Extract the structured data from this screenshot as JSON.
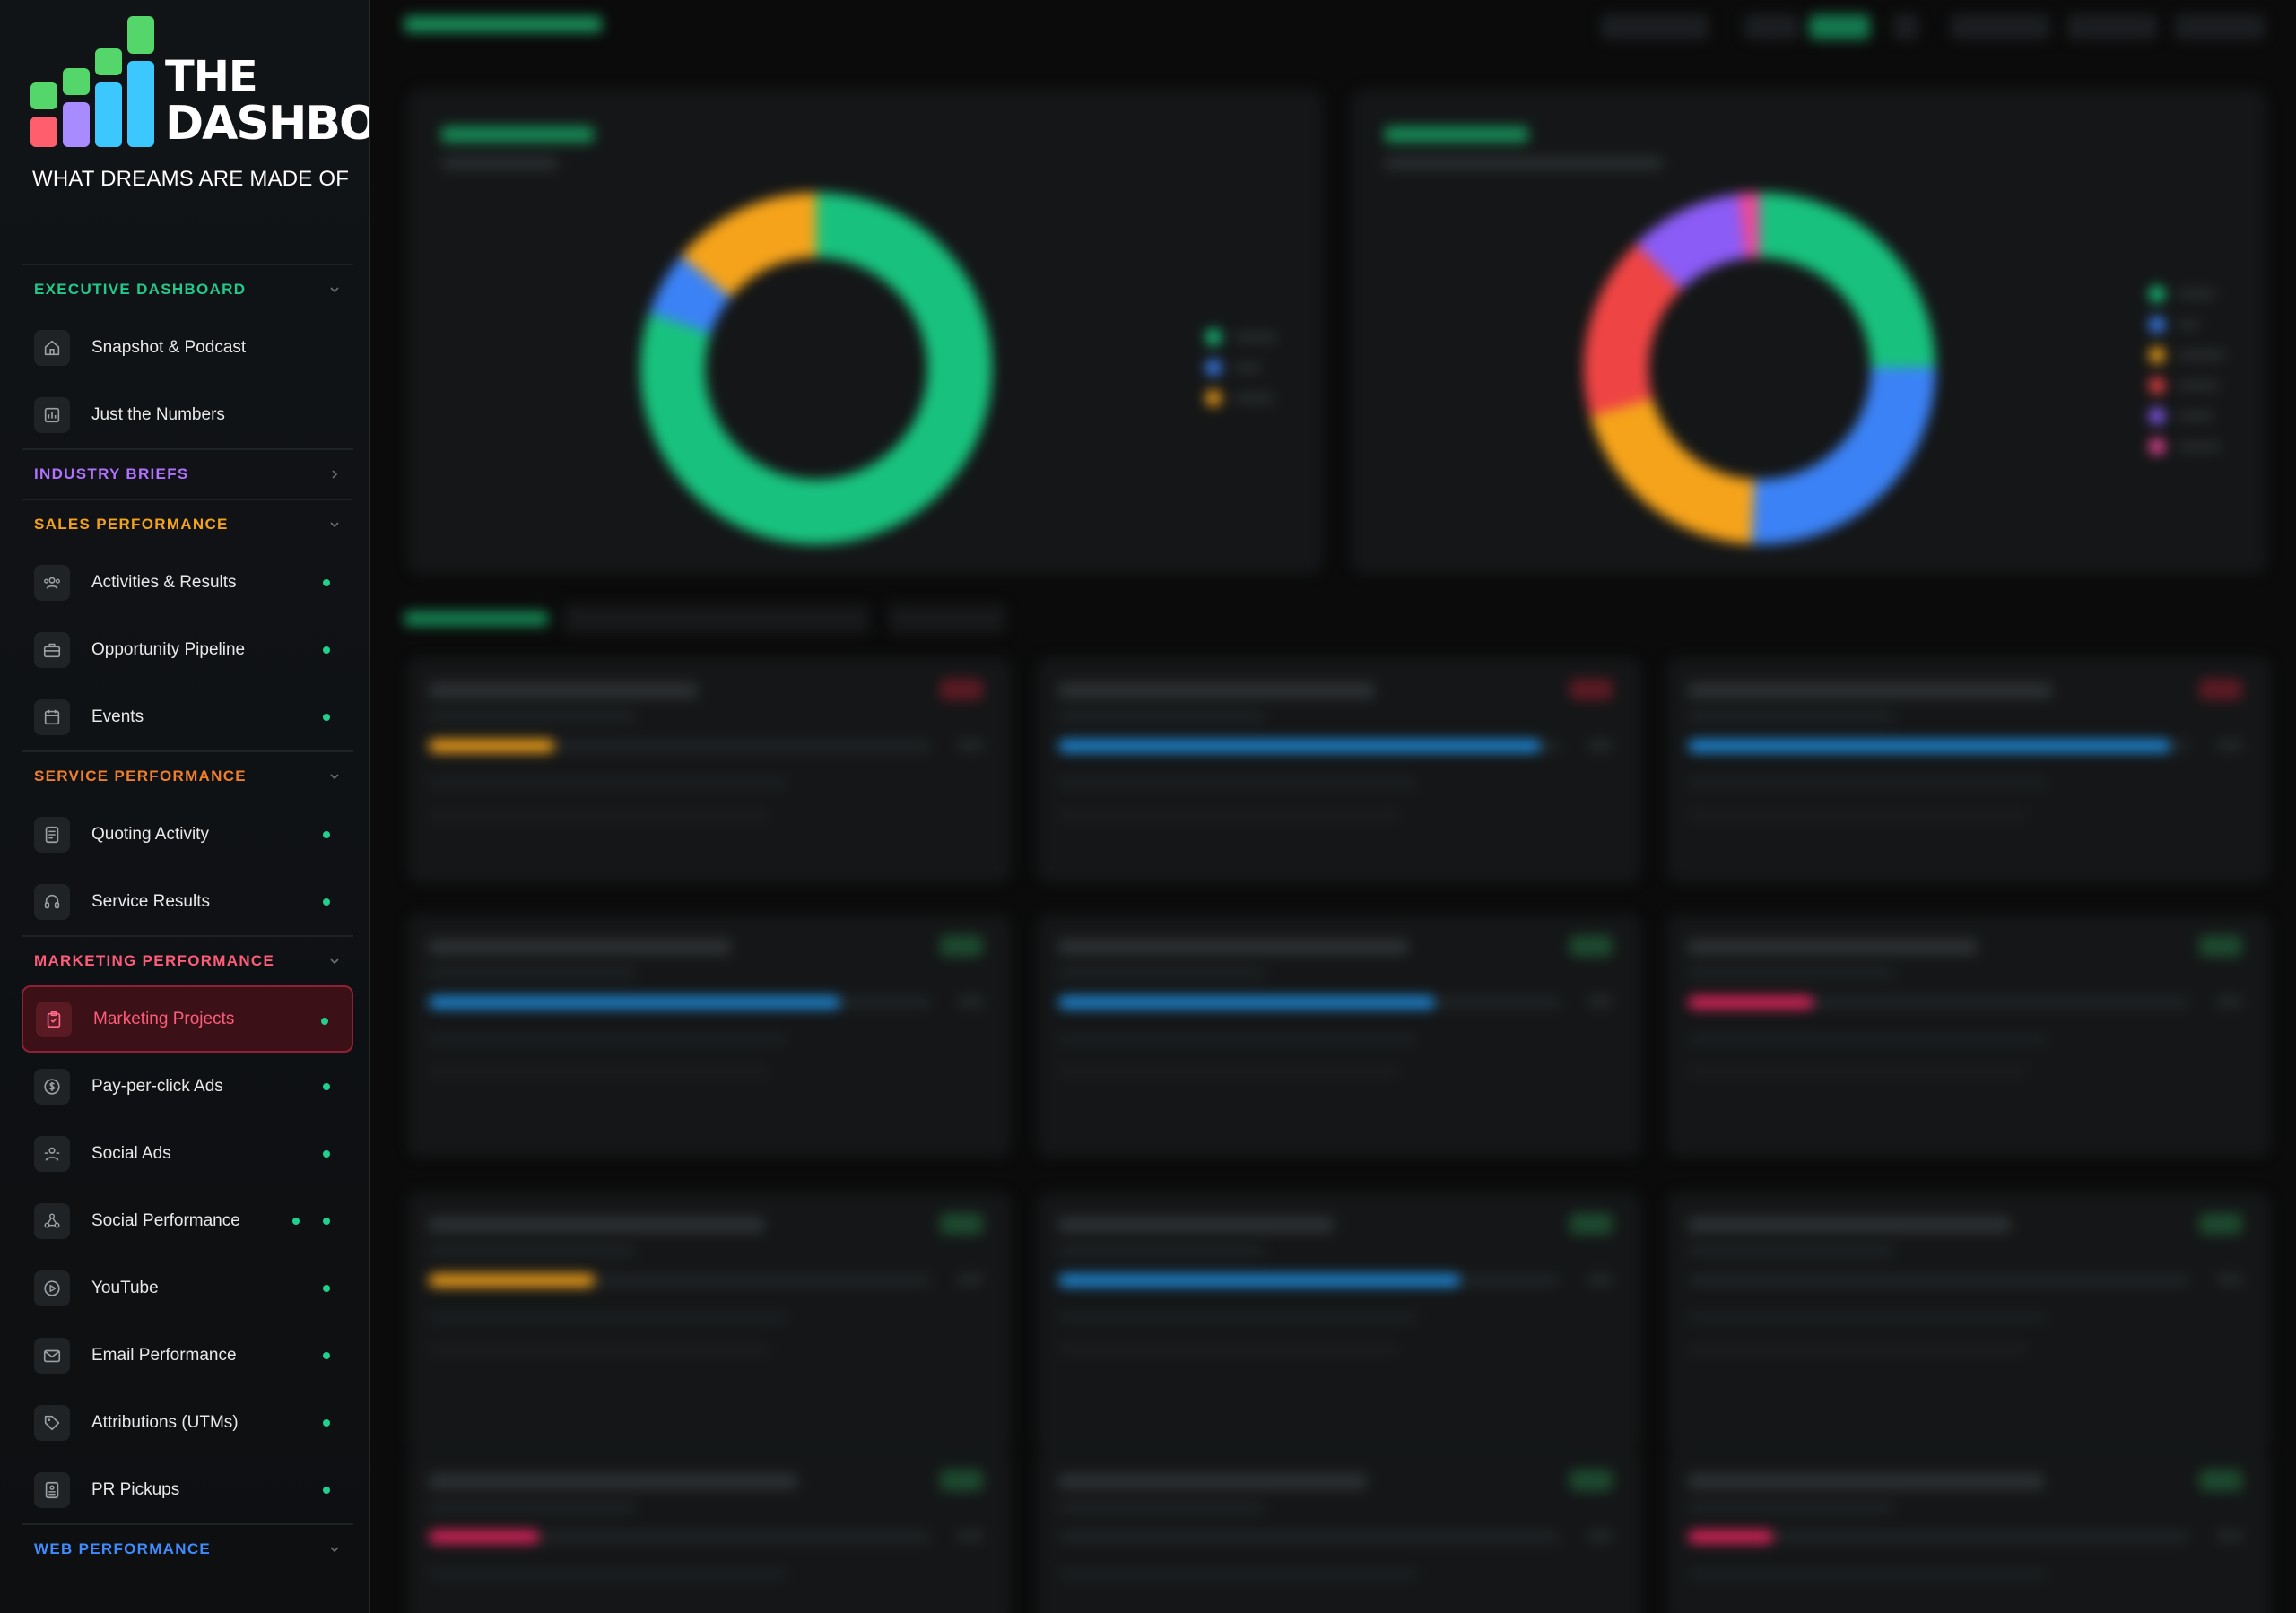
{
  "brand": {
    "title_line1": "THE",
    "title_line2": "DASHBOARD",
    "tagline": "WHAT DREAMS ARE MADE OF"
  },
  "colors": {
    "accent_green": "#1fd08f",
    "exec": "#22c98a",
    "industry": "#b072ff",
    "sales": "#f2a21b",
    "service": "#f07f2b",
    "marketing": "#ff5c7a",
    "web": "#3f8cff"
  },
  "sidebar": {
    "sections": [
      {
        "title": "EXECUTIVE DASHBOARD",
        "color": "#22c98a",
        "chevron": "chevron-down-icon",
        "items": [
          {
            "label": "Snapshot & Podcast",
            "icon": "home-icon",
            "dot": false
          },
          {
            "label": "Just the Numbers",
            "icon": "bar-chart-icon",
            "dot": false
          }
        ]
      },
      {
        "title": "INDUSTRY BRIEFS",
        "color": "#b072ff",
        "chevron": "chevron-right-icon",
        "items": []
      },
      {
        "title": "SALES PERFORMANCE",
        "color": "#f2a21b",
        "chevron": "chevron-down-icon",
        "items": [
          {
            "label": "Activities & Results",
            "icon": "users-icon",
            "dot": true
          },
          {
            "label": "Opportunity Pipeline",
            "icon": "briefcase-icon",
            "dot": true
          },
          {
            "label": "Events",
            "icon": "calendar-icon",
            "dot": true
          }
        ]
      },
      {
        "title": "SERVICE PERFORMANCE",
        "color": "#f07f2b",
        "chevron": "chevron-down-icon",
        "items": [
          {
            "label": "Quoting Activity",
            "icon": "document-icon",
            "dot": true
          },
          {
            "label": "Service Results",
            "icon": "headset-icon",
            "dot": true
          }
        ]
      },
      {
        "title": "MARKETING PERFORMANCE",
        "color": "#ff5c7a",
        "chevron": "chevron-down-icon",
        "items": [
          {
            "label": "Marketing Projects",
            "icon": "clipboard-check-icon",
            "dot": true,
            "active": true
          },
          {
            "label": "Pay-per-click Ads",
            "icon": "dollar-icon",
            "dot": true
          },
          {
            "label": "Social Ads",
            "icon": "megaphone-icon",
            "dot": true
          },
          {
            "label": "Social Performance",
            "icon": "network-icon",
            "dot": true,
            "dot2": true
          },
          {
            "label": "YouTube",
            "icon": "play-icon",
            "dot": true
          },
          {
            "label": "Email Performance",
            "icon": "mail-icon",
            "dot": true
          },
          {
            "label": "Attributions (UTMs)",
            "icon": "tag-icon",
            "dot": true
          },
          {
            "label": "PR Pickups",
            "icon": "newspaper-icon",
            "dot": true
          }
        ]
      },
      {
        "title": "WEB PERFORMANCE",
        "color": "#3f8cff",
        "chevron": "chevron-down-icon",
        "items": []
      }
    ]
  }
}
